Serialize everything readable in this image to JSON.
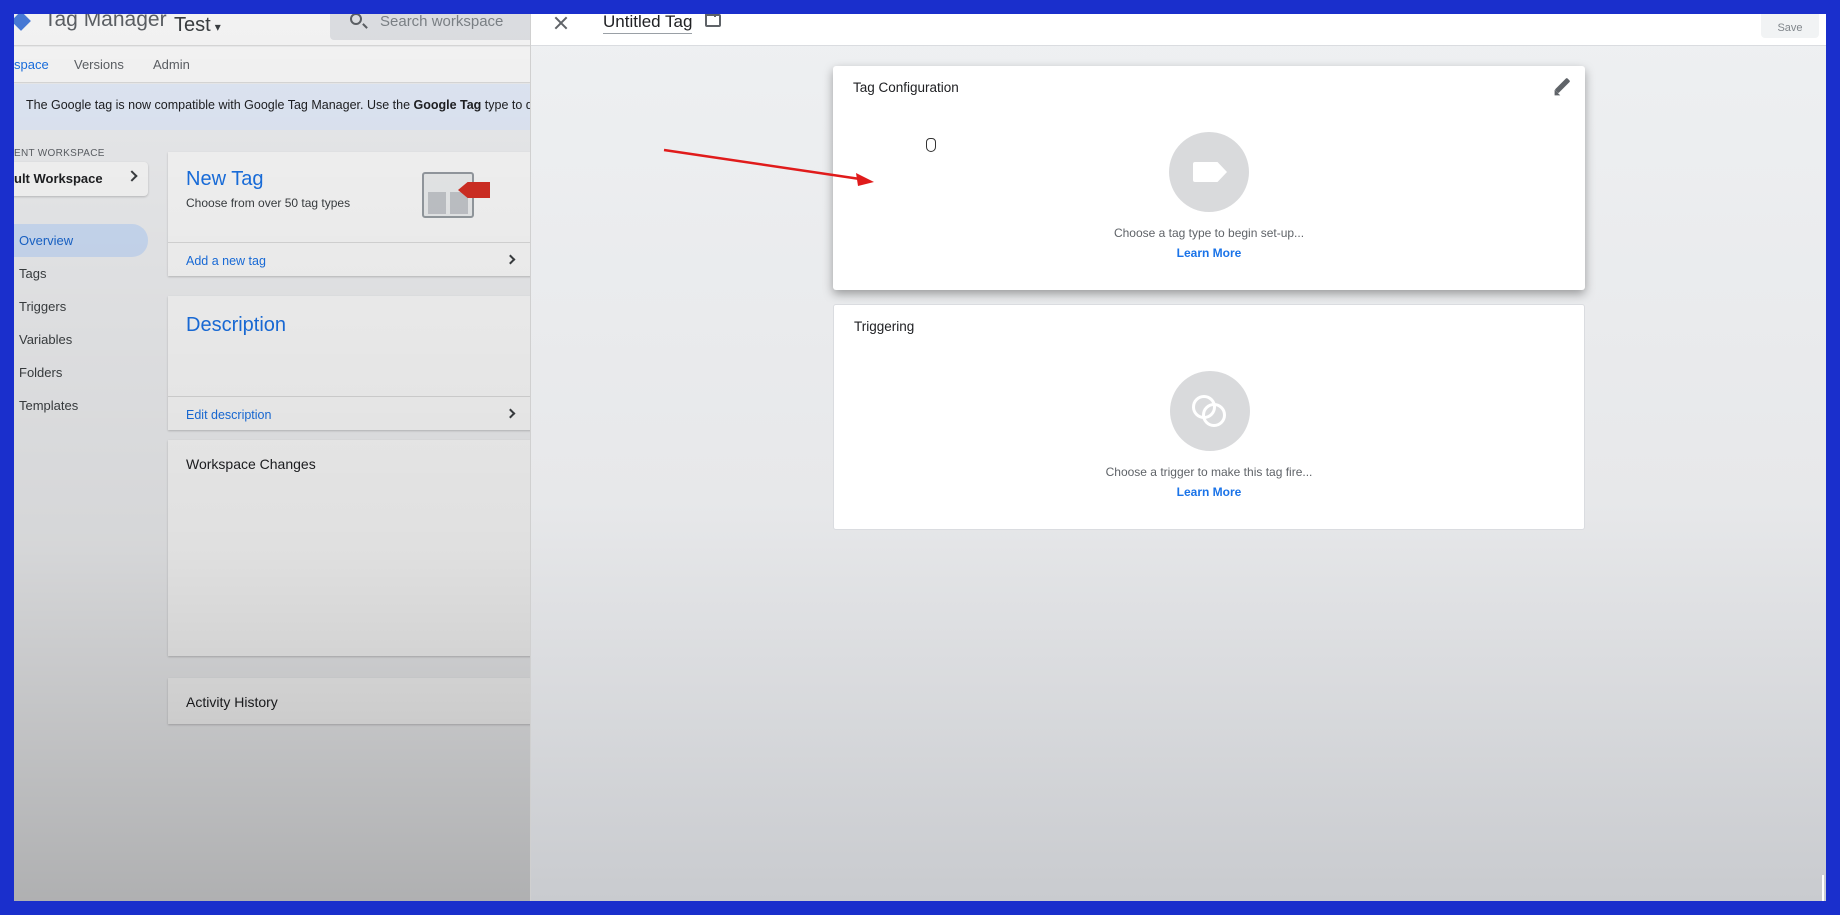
{
  "app": {
    "title": "Tag Manager",
    "container": "Test",
    "search_placeholder": "Search workspace"
  },
  "tabs": [
    "space",
    "Versions",
    "Admin"
  ],
  "banner": {
    "prefix": "The Google tag is now compatible with Google Tag Manager. Use the ",
    "bold": "Google Tag",
    "suffix": " type to deploy"
  },
  "workspace": {
    "label": "ENT WORKSPACE",
    "current": "ult Workspace"
  },
  "sidebar": {
    "items": [
      {
        "label": "Overview"
      },
      {
        "label": "Tags"
      },
      {
        "label": "Triggers"
      },
      {
        "label": "Variables"
      },
      {
        "label": "Folders"
      },
      {
        "label": "Templates"
      }
    ]
  },
  "overview_cards": {
    "new_tag": {
      "title": "New Tag",
      "subtitle": "Choose from over 50 tag types",
      "link": "Add a new tag"
    },
    "description": {
      "title": "Description",
      "link": "Edit description"
    },
    "workspace_changes": {
      "title": "Workspace Changes"
    },
    "activity_history": {
      "title": "Activity History"
    }
  },
  "sheet": {
    "tag_name": "Untitled Tag",
    "save_label": "Save",
    "tag_configuration": {
      "title": "Tag Configuration",
      "hint": "Choose a tag type to begin set-up...",
      "learn_more": "Learn More"
    },
    "triggering": {
      "title": "Triggering",
      "hint": "Choose a trigger to make this tag fire...",
      "learn_more": "Learn More"
    }
  },
  "colors": {
    "frame": "#1a2fcc",
    "accent_blue": "#1a73e8",
    "annotation_arrow": "#e01b1b"
  },
  "icons": [
    "tag-manager-logo-icon",
    "caret-down-icon",
    "search-icon",
    "chevron-right-icon",
    "close-icon",
    "folder-icon",
    "edit-icon",
    "tag-type-icon",
    "trigger-icon",
    "hand-cursor-icon"
  ]
}
